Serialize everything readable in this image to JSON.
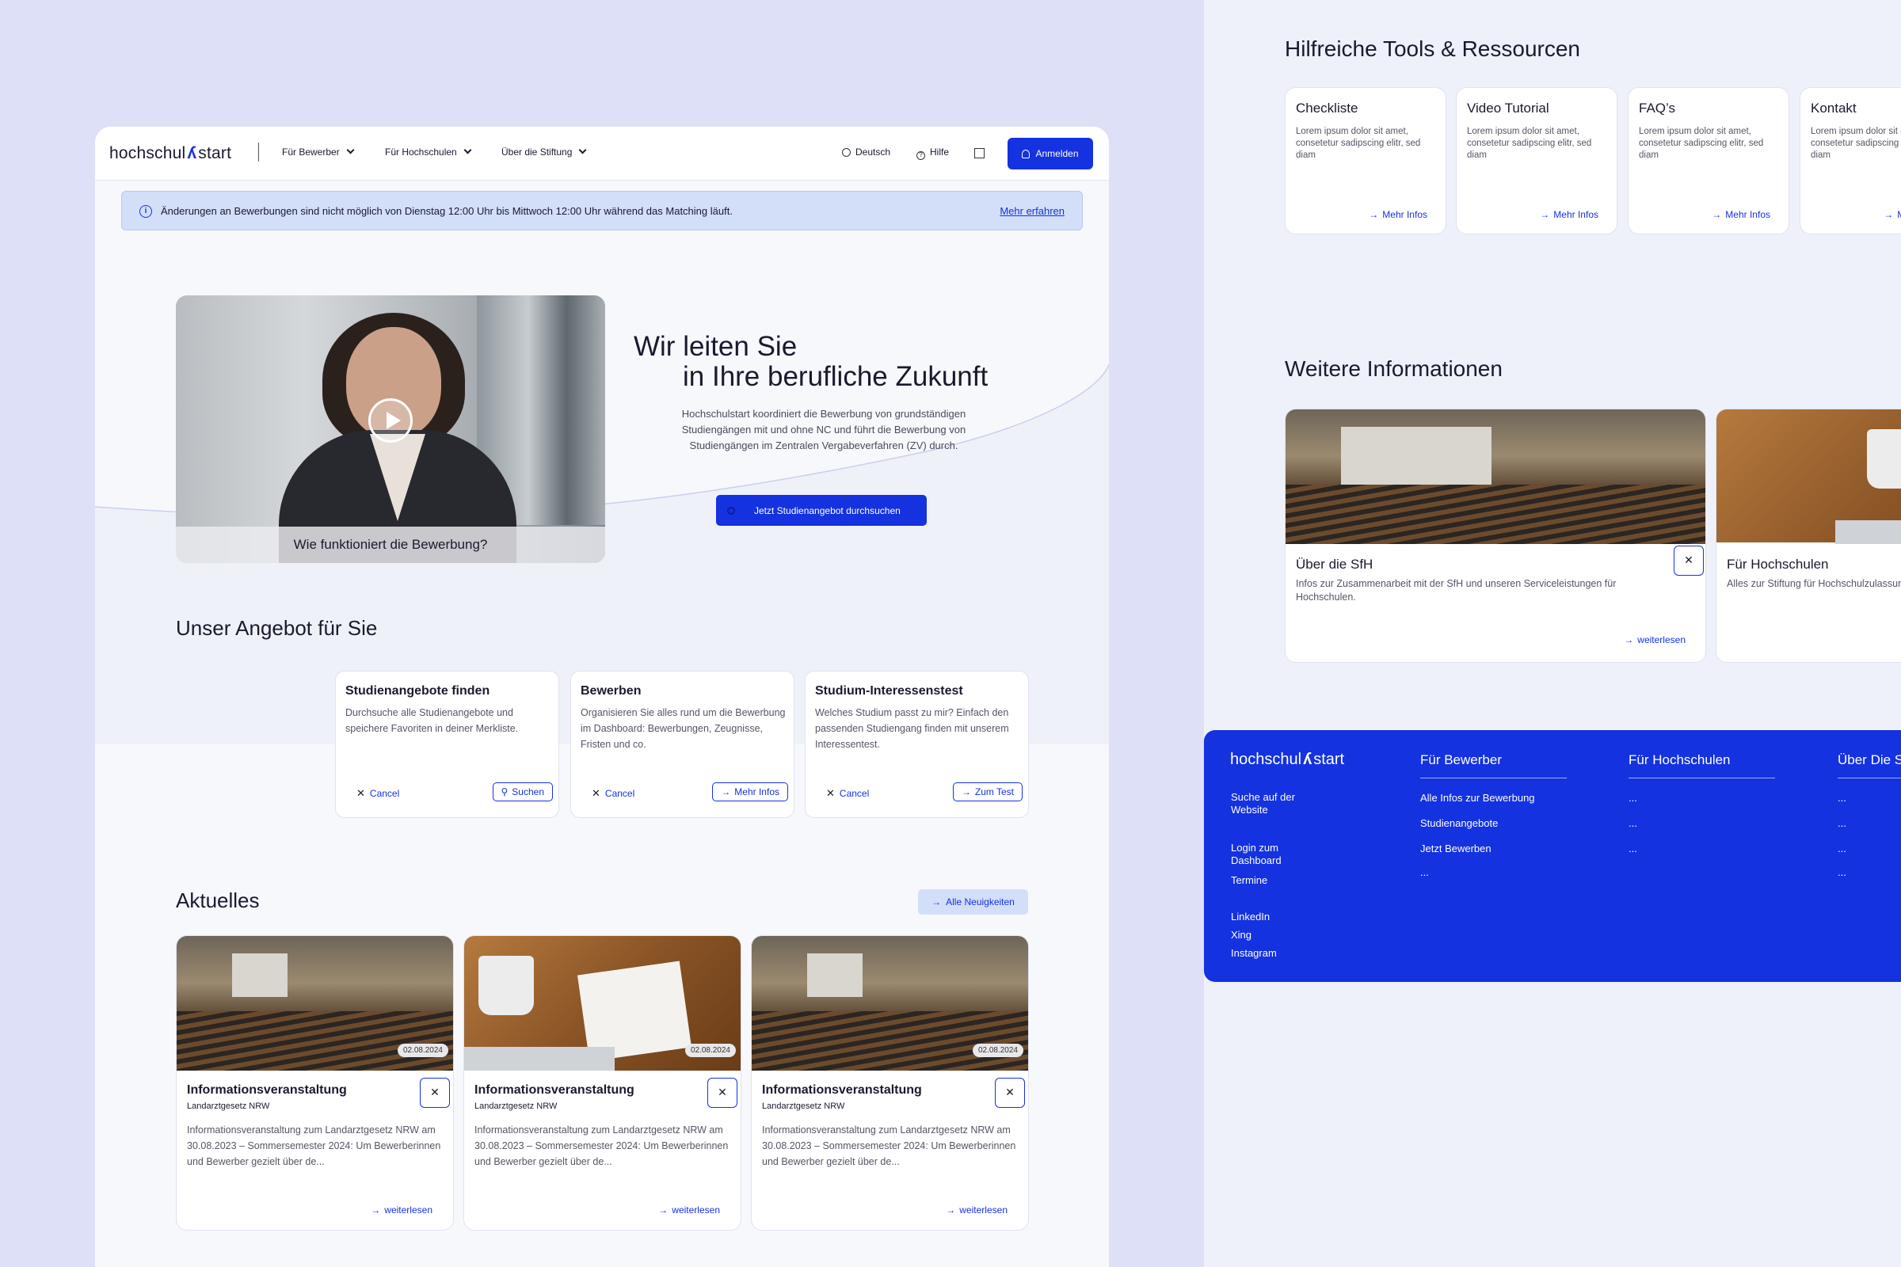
{
  "nav": {
    "logo_left": "hochschul",
    "logo_mark": "ʎ",
    "logo_right": "start",
    "items": [
      "Für Bewerber",
      "Für Hochschulen",
      "Über die Stiftung"
    ],
    "language": "Deutsch",
    "help": "Hilfe",
    "login": "Anmelden"
  },
  "notice": {
    "text": "Änderungen an Bewerbungen sind nicht möglich von Dienstag 12:00 Uhr bis Mittwoch 12:00 Uhr während das Matching läuft.",
    "link": "Mehr erfahren"
  },
  "hero": {
    "video_caption": "Wie funktioniert die Bewerbung?",
    "title_line1": "Wir leiten Sie",
    "title_line2": "in Ihre berufliche Zukunft",
    "text": "Hochschulstart koordiniert die Bewerbung von grundständigen Studiengängen mit und ohne NC und führt die Bewerbung von Studiengängen im Zentralen Vergabeverfahren (ZV) durch.",
    "cta": "Jetzt Studienangebot durchsuchen"
  },
  "offer": {
    "title": "Unser Angebot für Sie",
    "cancel_label": "Cancel",
    "cards": [
      {
        "title": "Studienangebote finden",
        "text": "Durchsuche alle Studienangebote und speichere Favoriten in deiner Merkliste.",
        "action": "Suchen"
      },
      {
        "title": "Bewerben",
        "text": "Organisieren Sie alles rund um die Bewerbung im Dashboard: Bewerbungen, Zeugnisse, Fristen und co.",
        "action": "Mehr Infos"
      },
      {
        "title": "Studium-Interessenstest",
        "text": "Welches Studium passt zu mir? Einfach den passenden Studiengang finden mit unserem Interessentest.",
        "action": "Zum Test"
      }
    ]
  },
  "news": {
    "title": "Aktuelles",
    "all_button": "Alle Neuigkeiten",
    "more_label": "weiterlesen",
    "items": [
      {
        "date": "02.08.2024",
        "title": "Informationsveranstaltung",
        "subtitle": "Landarztgesetz NRW",
        "text": "Informationsveranstaltung zum Landarztgesetz NRW am 30.08.2023 – Sommersemester 2024: Um Bewerberinnen und Bewerber gezielt über de..."
      },
      {
        "date": "02.08.2024",
        "title": "Informationsveranstaltung",
        "subtitle": "Landarztgesetz NRW",
        "text": "Informationsveranstaltung zum Landarztgesetz NRW am 30.08.2023 – Sommersemester 2024: Um Bewerberinnen und Bewerber gezielt über de..."
      },
      {
        "date": "02.08.2024",
        "title": "Informationsveranstaltung",
        "subtitle": "Landarztgesetz NRW",
        "text": "Informationsveranstaltung zum Landarztgesetz NRW am 30.08.2023 – Sommersemester 2024: Um Bewerberinnen und Bewerber gezielt über de..."
      }
    ]
  },
  "tools": {
    "title": "Hilfreiche Tools & Ressourcen",
    "more_label": "Mehr Infos",
    "items": [
      {
        "title": "Checkliste",
        "text": "Lorem ipsum dolor sit amet, consetetur sadipscing elitr, sed diam"
      },
      {
        "title": "Video Tutorial",
        "text": "Lorem ipsum dolor sit amet, consetetur sadipscing elitr, sed diam"
      },
      {
        "title": "FAQ’s",
        "text": "Lorem ipsum dolor sit amet, consetetur sadipscing elitr, sed diam"
      },
      {
        "title": "Kontakt",
        "text": "Lorem ipsum dolor sit amet, consetetur sadipscing elitr, sed diam"
      }
    ]
  },
  "further": {
    "title": "Weitere Informationen",
    "more_label": "weiterlesen",
    "items": [
      {
        "title": "Über die SfH",
        "text": "Infos zur Zusammenarbeit mit der SfH und unseren Serviceleistungen für Hochschulen."
      },
      {
        "title": "Für Hochschulen",
        "text": "Alles zur Stiftung für Hochschulzulassung und Neuigkeiten."
      }
    ]
  },
  "footer": {
    "logo_left": "hochschul",
    "logo_mark": "ʎ",
    "logo_right": "start",
    "links": [
      "Suche auf der Website",
      "Login zum Dashboard",
      "Termine",
      "LinkedIn",
      "Xing",
      "Instagram"
    ],
    "col1": {
      "title": "Für Bewerber",
      "items": [
        "Alle Infos zur Bewerbung",
        "Studienangebote",
        "Jetzt Bewerben",
        "..."
      ]
    },
    "col2": {
      "title": "Für Hochschulen",
      "items": [
        "...",
        "...",
        "..."
      ]
    },
    "col3": {
      "title": "Über Die Stiftung",
      "items": [
        "...",
        "...",
        "...",
        "..."
      ]
    }
  },
  "colors": {
    "accent": "#1432e0",
    "background": "#dde0f7",
    "notice": "#d3def9"
  }
}
